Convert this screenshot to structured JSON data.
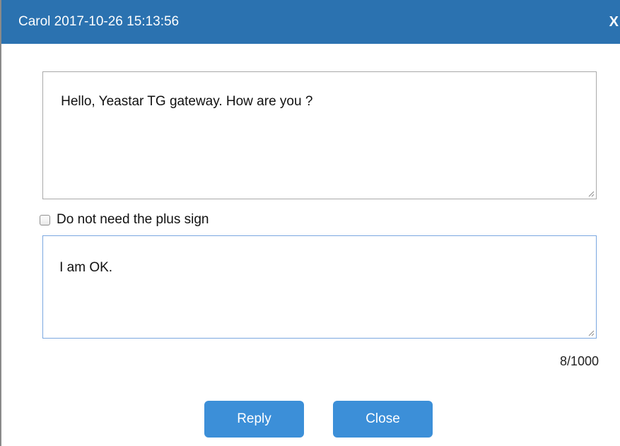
{
  "dialog": {
    "title": "Carol 2017-10-26 15:13:56",
    "close_glyph": "X"
  },
  "received_message": {
    "text": "Hello, Yeastar TG gateway. How are you ?"
  },
  "options": {
    "plus_sign_label": "Do not need the plus sign",
    "plus_sign_checked": false
  },
  "reply": {
    "text": "I am OK.",
    "counter": "8/1000"
  },
  "buttons": {
    "reply_label": "Reply",
    "close_label": "Close"
  },
  "colors": {
    "titlebar": "#2b72b0",
    "button": "#3c8fd8",
    "focus_border": "#7aa7e0"
  }
}
